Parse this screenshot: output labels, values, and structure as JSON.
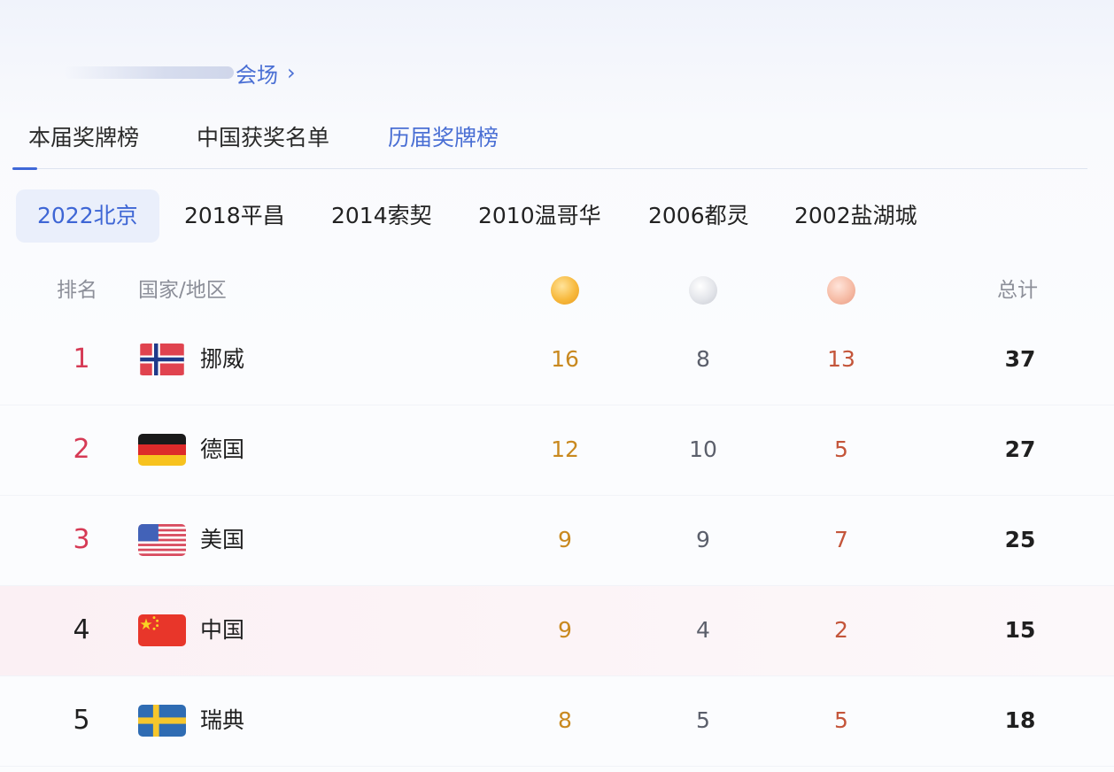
{
  "venue": {
    "label": "会场",
    "chevron": "›"
  },
  "tabs": [
    {
      "label": "本届奖牌榜"
    },
    {
      "label": "中国获奖名单"
    },
    {
      "label": "历届奖牌榜"
    }
  ],
  "years": [
    {
      "label": "2022北京"
    },
    {
      "label": "2018平昌"
    },
    {
      "label": "2014索契"
    },
    {
      "label": "2010温哥华"
    },
    {
      "label": "2006都灵"
    },
    {
      "label": "2002盐湖城"
    }
  ],
  "table": {
    "headers": {
      "rank": "排名",
      "country": "国家/地区",
      "total": "总计"
    },
    "medal_icons": [
      "gold-medal-icon",
      "silver-medal-icon",
      "bronze-medal-icon"
    ],
    "rows": [
      {
        "rank": "1",
        "country": "挪威",
        "flag": "norway-flag-icon",
        "gold": "16",
        "silver": "8",
        "bronze": "13",
        "total": "37"
      },
      {
        "rank": "2",
        "country": "德国",
        "flag": "germany-flag-icon",
        "gold": "12",
        "silver": "10",
        "bronze": "5",
        "total": "27"
      },
      {
        "rank": "3",
        "country": "美国",
        "flag": "usa-flag-icon",
        "gold": "9",
        "silver": "9",
        "bronze": "7",
        "total": "25"
      },
      {
        "rank": "4",
        "country": "中国",
        "flag": "china-flag-icon",
        "gold": "9",
        "silver": "4",
        "bronze": "2",
        "total": "15"
      },
      {
        "rank": "5",
        "country": "瑞典",
        "flag": "sweden-flag-icon",
        "gold": "8",
        "silver": "5",
        "bronze": "5",
        "total": "18"
      }
    ]
  },
  "colors": {
    "accent": "#3e66d5",
    "rank_top3": "#d63a55",
    "gold": "#c9891f",
    "bronze": "#c4553a",
    "highlight_row": "#fbf0f4"
  }
}
